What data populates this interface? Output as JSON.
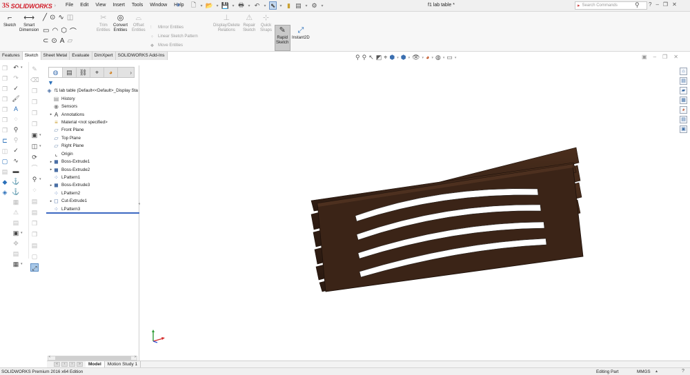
{
  "app": {
    "brand": "SOLIDWORKS",
    "document_title": "f1 lab table *",
    "menu": [
      "File",
      "Edit",
      "View",
      "Insert",
      "Tools",
      "Window",
      "Help"
    ],
    "search_placeholder": "Search Commands"
  },
  "commands": {
    "sketch": "Sketch",
    "smart_dimension_1": "Smart",
    "smart_dimension_2": "Dimension",
    "trim_1": "Trim",
    "trim_2": "Entities",
    "convert_1": "Convert",
    "convert_2": "Entities",
    "offset_1": "Offset",
    "offset_2": "Entities",
    "mirror": "Mirror Entities",
    "linear_pattern": "Linear Sketch Pattern",
    "move": "Move Entities",
    "display_delete_1": "Display/Delete",
    "display_delete_2": "Relations",
    "repair_1": "Repair",
    "repair_2": "Sketch",
    "quick_snaps_1": "Quick",
    "quick_snaps_2": "Snaps",
    "rapid_1": "Rapid",
    "rapid_2": "Sketch",
    "instant2d": "Instant2D"
  },
  "cmd_tabs": [
    "Features",
    "Sketch",
    "Sheet Metal",
    "Evaluate",
    "DimXpert",
    "SOLIDWORKS Add-Ins"
  ],
  "active_cmd_tab": "Sketch",
  "tree": {
    "root": "f1 lab table  (Default<<Default>_Display Sta",
    "items": [
      {
        "label": "History",
        "expand": ""
      },
      {
        "label": "Sensors",
        "expand": ""
      },
      {
        "label": "Annotations",
        "expand": "▸"
      },
      {
        "label": "Material <not specified>",
        "expand": ""
      },
      {
        "label": "Front Plane",
        "expand": ""
      },
      {
        "label": "Top Plane",
        "expand": ""
      },
      {
        "label": "Right Plane",
        "expand": ""
      },
      {
        "label": "Origin",
        "expand": ""
      },
      {
        "label": "Boss-Extrude1",
        "expand": "▸"
      },
      {
        "label": "Boss-Extrude2",
        "expand": "▸"
      },
      {
        "label": "LPattern1",
        "expand": ""
      },
      {
        "label": "Boss-Extrude3",
        "expand": "▸"
      },
      {
        "label": "LPattern2",
        "expand": ""
      },
      {
        "label": "Cut-Extrude1",
        "expand": "▸"
      },
      {
        "label": "LPattern3",
        "expand": ""
      }
    ]
  },
  "bottom_tabs": [
    "Model",
    "Motion Study 1"
  ],
  "status": {
    "edition": "SOLIDWORKS Premium 2016 x64 Edition",
    "mode": "Editing Part",
    "units": "MMGS"
  },
  "colors": {
    "wood": "#3a2418",
    "brand_red": "#d2202c",
    "accent_blue": "#3b67c1"
  }
}
